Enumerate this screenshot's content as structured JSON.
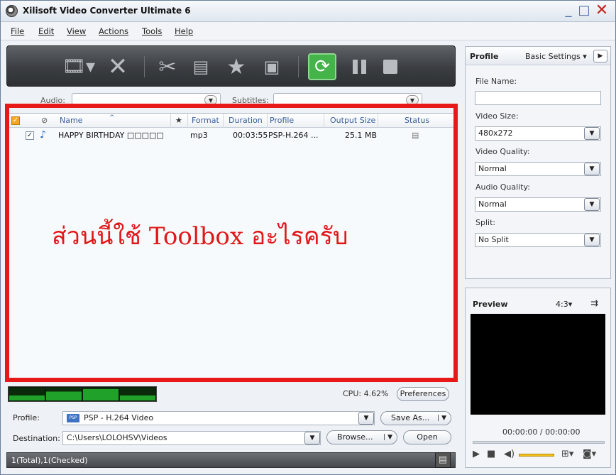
{
  "window": {
    "title": "Xilisoft Video Converter Ultimate 6"
  },
  "menu": [
    "File",
    "Edit",
    "View",
    "Actions",
    "Tools",
    "Help"
  ],
  "filter": {
    "audio_label": "Audio:",
    "subtitles_label": "Subtitles:"
  },
  "list": {
    "headers": {
      "name": "Name",
      "star": "★",
      "format": "Format",
      "duration": "Duration",
      "profile": "Profile",
      "output_size": "Output Size",
      "status": "Status"
    },
    "rows": [
      {
        "name": "HAPPY BIRTHDAY □□□□□",
        "format": "mp3",
        "duration": "00:03:55",
        "profile": "PSP-H.264 ...",
        "output_size": "25.1 MB"
      }
    ]
  },
  "annotation": "ส่วนนี้ใช้ Toolbox อะไรครับ",
  "status": {
    "cpu": "CPU: 4.62%",
    "preferences": "Preferences",
    "profile_label": "Profile:",
    "profile_value": "PSP - H.264 Video",
    "save_as": "Save As...",
    "destination_label": "Destination:",
    "destination_value": "C:\\Users\\LOLOHSV\\Videos",
    "browse": "Browse...",
    "open": "Open",
    "summary": "1(Total),1(Checked)"
  },
  "side": {
    "title": "Profile",
    "tab": "Basic Settings",
    "file_name_label": "File Name:",
    "file_name_value": "",
    "video_size_label": "Video Size:",
    "video_size_value": "480x272",
    "video_quality_label": "Video Quality:",
    "video_quality_value": "Normal",
    "audio_quality_label": "Audio Quality:",
    "audio_quality_value": "Normal",
    "split_label": "Split:",
    "split_value": "No Split"
  },
  "preview": {
    "title": "Preview",
    "ratio": "4:3",
    "time": "00:00:00 / 00:00:00"
  },
  "colors": {
    "accent_red": "#e81818",
    "convert_green": "#44b34a"
  },
  "icons": [
    "add-video-icon",
    "delete-icon",
    "clip-icon",
    "merge-icon",
    "effects-icon",
    "snapshot-icon",
    "convert-icon",
    "pause-icon",
    "stop-icon",
    "audio-file-icon",
    "status-file-icon"
  ]
}
